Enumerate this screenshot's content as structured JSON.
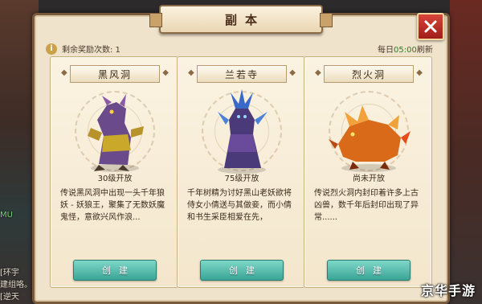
{
  "window": {
    "title": "副本",
    "close_label": "✕"
  },
  "info": {
    "remaining_label": "剩余奖励次数: 1"
  },
  "refresh": {
    "prefix": "每日",
    "time": "05:00",
    "suffix": "刷新"
  },
  "cards": [
    {
      "name": "黑风洞",
      "level": "30级开放",
      "desc": "传说黑风洞中出现一头千年狼妖 - 妖狼王，聚集了无数妖魔鬼怪，意欲兴风作浪...",
      "button": "创建",
      "monster_icon": "wolf-demon-icon",
      "color": "#b89a2a"
    },
    {
      "name": "兰若寺",
      "level": "75级开放",
      "desc": "千年树精为讨好黑山老妖欲将侍女小倩送与其做妾，而小倩和书生采臣相爱在先，",
      "button": "创建",
      "monster_icon": "tree-spirit-icon",
      "color": "#3a4a9a"
    },
    {
      "name": "烈火洞",
      "level": "尚未开放",
      "desc": "传说烈火洞内封印着许多上古凶兽，数千年后封印出现了异常......",
      "button": "创建",
      "monster_icon": "fire-beast-icon",
      "color": "#d8782a"
    }
  ],
  "background": {
    "chat_lines": [
      "MU",
      "[环宇",
      "建组咯。",
      "[逆天"
    ]
  },
  "watermark": "京华手游"
}
